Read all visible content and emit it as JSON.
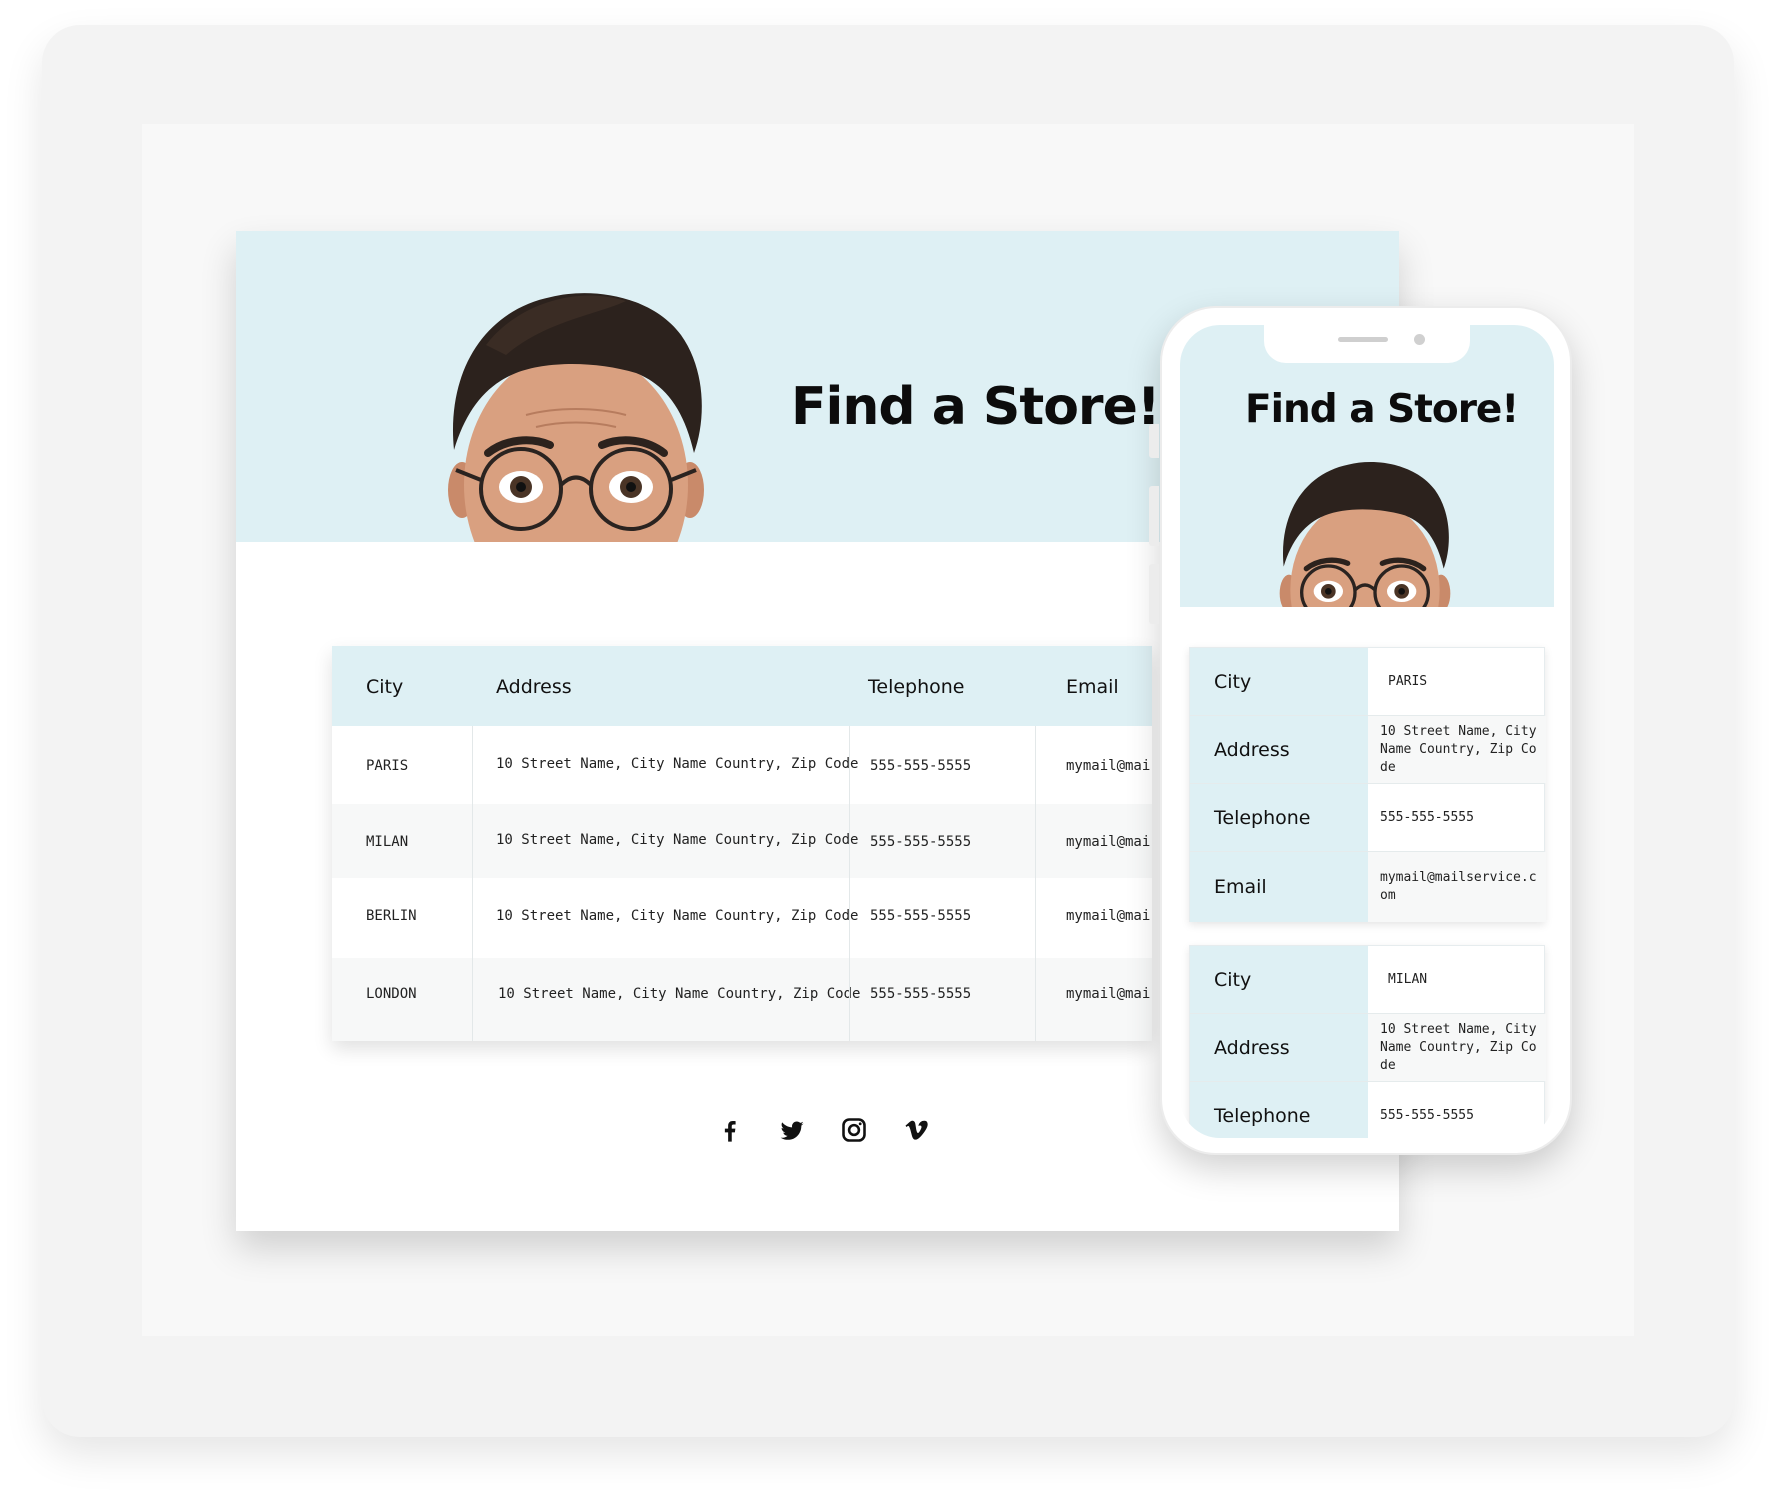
{
  "desktop": {
    "title": "Find a Store!",
    "table": {
      "headers": [
        "City",
        "Address",
        "Telephone",
        "Email"
      ],
      "rows": [
        {
          "city": "PARIS",
          "address": "10 Street Name, City Name Country, Zip Code",
          "telephone": "555-555-5555",
          "email": "mymail@mai"
        },
        {
          "city": "MILAN",
          "address": "10 Street Name, City Name Country, Zip Code",
          "telephone": "555-555-5555",
          "email": "mymail@mai"
        },
        {
          "city": "BERLIN",
          "address": "10 Street Name, City Name Country, Zip Code",
          "telephone": "555-555-5555",
          "email": "mymail@mai"
        },
        {
          "city": "LONDON",
          "address": "10 Street Name, City Name Country, Zip Code",
          "telephone": "555-555-5555",
          "email": "mymail@mai"
        }
      ]
    },
    "social": [
      "facebook-icon",
      "twitter-icon",
      "instagram-icon",
      "vimeo-icon"
    ]
  },
  "mobile": {
    "title": "Find a Store!",
    "cards": [
      {
        "city_label": "City",
        "city": "PARIS",
        "address_label": "Address",
        "address": "10 Street Name, City Name Country, Zip Code",
        "telephone_label": "Telephone",
        "telephone": "555-555-5555",
        "email_label": "Email",
        "email": "mymail@mailservice.com"
      },
      {
        "city_label": "City",
        "city": "MILAN",
        "address_label": "Address",
        "address": "10 Street Name, City Name Country, Zip Code",
        "telephone_label": "Telephone",
        "telephone": "555-555-5555"
      }
    ]
  },
  "colors": {
    "hero_bg": "#def0f4",
    "header_bg": "#def0f4",
    "title": "#0c0c0c"
  }
}
